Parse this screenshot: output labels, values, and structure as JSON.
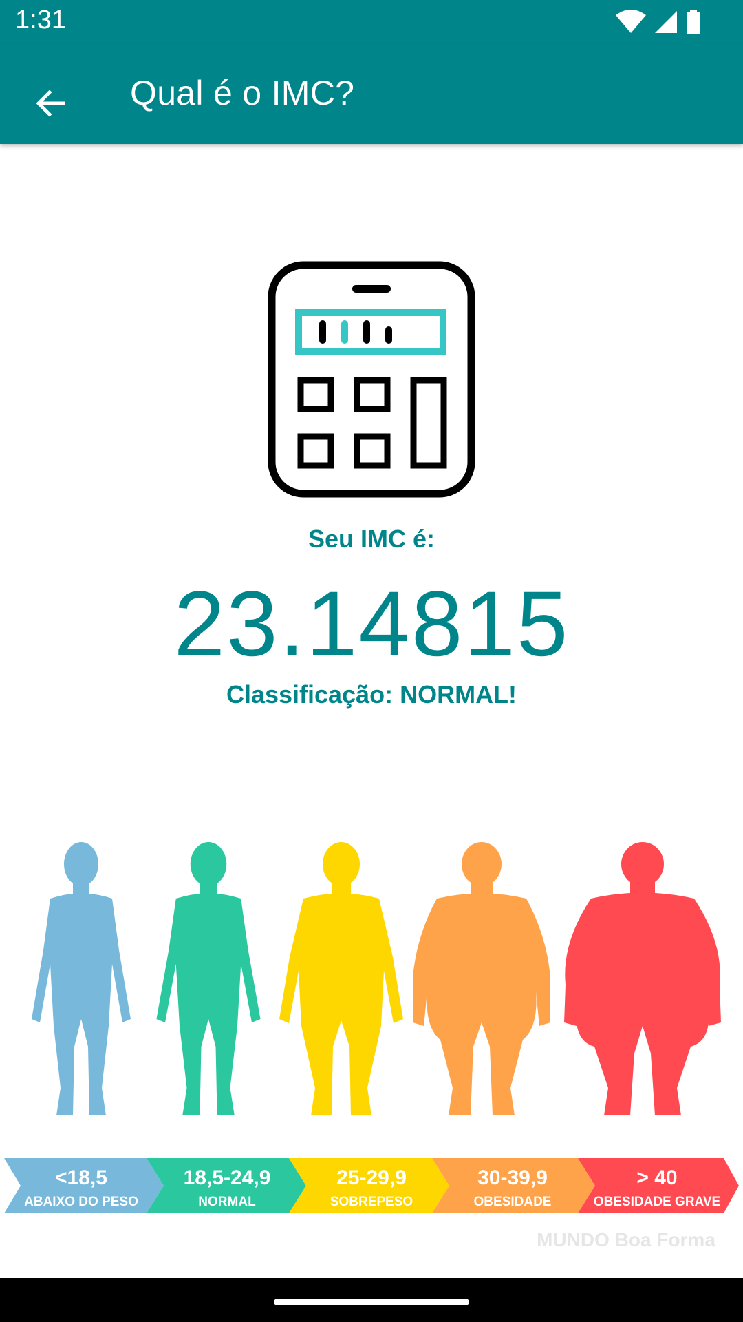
{
  "status_bar": {
    "time": "1:31"
  },
  "app_bar": {
    "title": "Qual é o IMC?",
    "back_icon": "arrow-back-icon"
  },
  "result": {
    "label": "Seu IMC é:",
    "value": "23.14815",
    "classification": "Classificação: NORMAL!"
  },
  "colors": {
    "primary": "#00868A",
    "underweight": "#77B8DB",
    "normal": "#2BC8A0",
    "overweight": "#FFD700",
    "obesity": "#FFA34A",
    "severe_obesity": "#FF4A52",
    "calc_accent": "#37C6C6"
  },
  "bmi_scale": [
    {
      "range": "<18,5",
      "label": "ABAIXO DO PESO"
    },
    {
      "range": "18,5-24,9",
      "label": "NORMAL"
    },
    {
      "range": "25-29,9",
      "label": "SOBREPESO"
    },
    {
      "range": "30-39,9",
      "label": "OBESIDADE"
    },
    {
      "range": "> 40",
      "label": "OBESIDADE GRAVE"
    }
  ],
  "watermark": "MUNDO Boa Forma"
}
